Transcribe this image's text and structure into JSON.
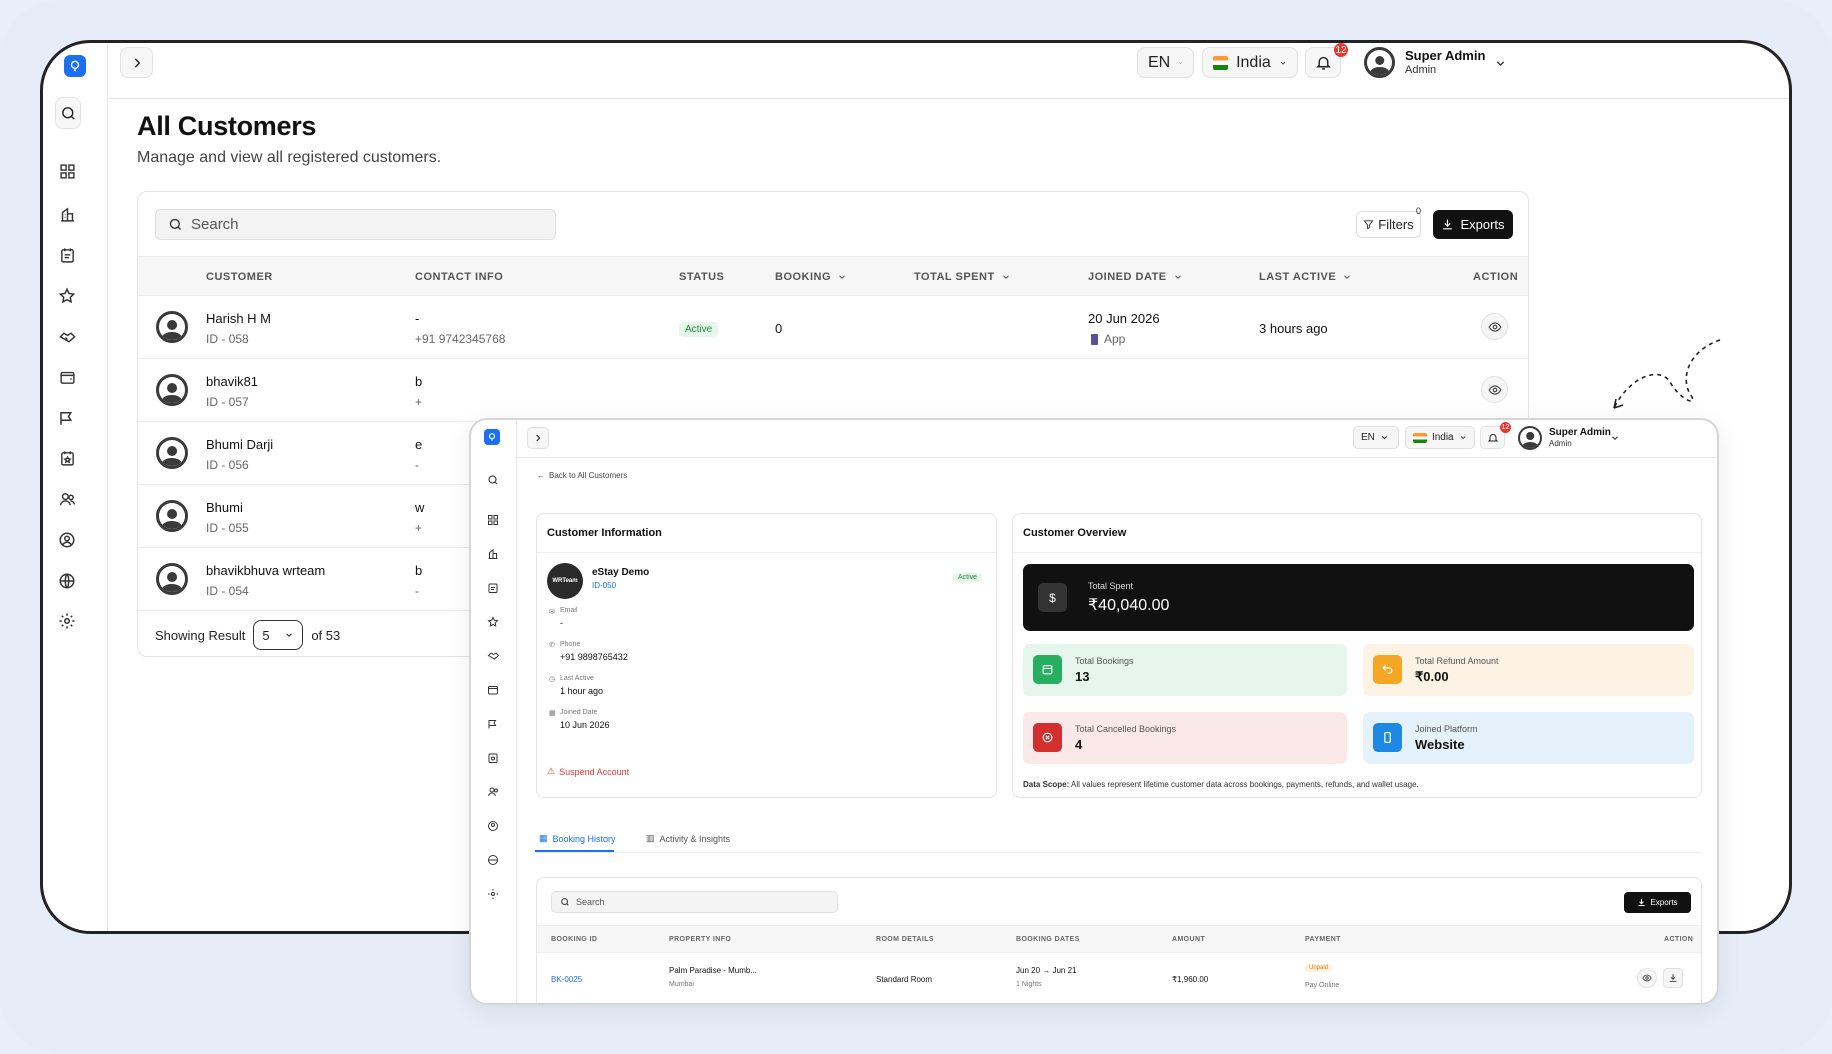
{
  "header": {
    "lang": "EN",
    "country": "India",
    "notif_count": "12",
    "user_name": "Super Admin",
    "user_role": "Admin"
  },
  "page": {
    "title": "All Customers",
    "subtitle": "Manage and view all registered customers."
  },
  "toolbar": {
    "search_placeholder": "Search",
    "filters_label": "Filters",
    "filters_count": "0",
    "exports_label": "Exports"
  },
  "table": {
    "headers": [
      "CUSTOMER",
      "CONTACT INFO",
      "STATUS",
      "BOOKING",
      "TOTAL SPENT",
      "JOINED DATE",
      "LAST ACTIVE",
      "ACTION"
    ],
    "rows": [
      {
        "name": "Harish H M",
        "id": "ID - 058",
        "email": "-",
        "phone": "+91 9742345768",
        "status": "Active",
        "booking": "0",
        "joined": "20 Jun 2026",
        "source": "App",
        "last_active": "3 hours ago"
      },
      {
        "name": "bhavik81",
        "id": "ID - 057",
        "email": "b",
        "phone": "+"
      },
      {
        "name": "Bhumi Darji",
        "id": "ID - 056",
        "email": "e",
        "phone": "-"
      },
      {
        "name": "Bhumi",
        "id": "ID - 055",
        "email": "w",
        "phone": "+"
      },
      {
        "name": "bhavikbhuva wrteam",
        "id": "ID - 054",
        "email": "b",
        "phone": "-"
      }
    ]
  },
  "pagination": {
    "showing_label": "Showing Result",
    "page_size": "5",
    "of_total": "of 53"
  },
  "detail": {
    "header": {
      "lang": "EN",
      "country": "India",
      "notif_count": "12",
      "user_name": "Super Admin",
      "user_role": "Admin"
    },
    "back_link": "Back to All Customers",
    "info": {
      "title": "Customer Information",
      "name": "eStay Demo",
      "id": "ID-050",
      "status": "Active",
      "logo_text": "WRTeam",
      "email_label": "Email",
      "email": "-",
      "phone_label": "Phone",
      "phone": "+91 9898765432",
      "last_active_label": "Last Active",
      "last_active": "1 hour ago",
      "joined_label": "Joined Date",
      "joined": "10 Jun 2026",
      "suspend": "Suspend Account"
    },
    "overview": {
      "title": "Customer Overview",
      "total_spent_label": "Total Spent",
      "total_spent": "₹40,040.00",
      "bookings_label": "Total Bookings",
      "bookings": "13",
      "refund_label": "Total Refund Amount",
      "refund": "₹0.00",
      "cancelled_label": "Total Cancelled Bookings",
      "cancelled": "4",
      "platform_label": "Joined Platform",
      "platform": "Website",
      "scope_bold": "Data Scope:",
      "scope_text": "All values represent lifetime customer data across bookings, payments, refunds, and wallet usage."
    },
    "tabs": [
      "Booking History",
      "Activity & Insights"
    ],
    "search_placeholder": "Search",
    "exports_label": "Exports",
    "headers": [
      "BOOKING ID",
      "PROPERTY INFO",
      "ROOM DETAILS",
      "BOOKING DATES",
      "AMOUNT",
      "PAYMENT",
      "ACTION"
    ],
    "row": {
      "id": "BK-0025",
      "property": "Palm Paradise - Mumb...",
      "city": "Mumbai",
      "room": "Standard Room",
      "dates": "Jun 20 → Jun 21",
      "nights": "1 Nights",
      "amount": "₹1,960.00",
      "payment_status": "Unpaid",
      "payment_method": "Pay Online"
    }
  },
  "colors": {
    "accent": "#1b6ff2",
    "active_bg": "#e7f6ea",
    "active_fg": "#1a8f3a",
    "danger": "#e53935"
  }
}
